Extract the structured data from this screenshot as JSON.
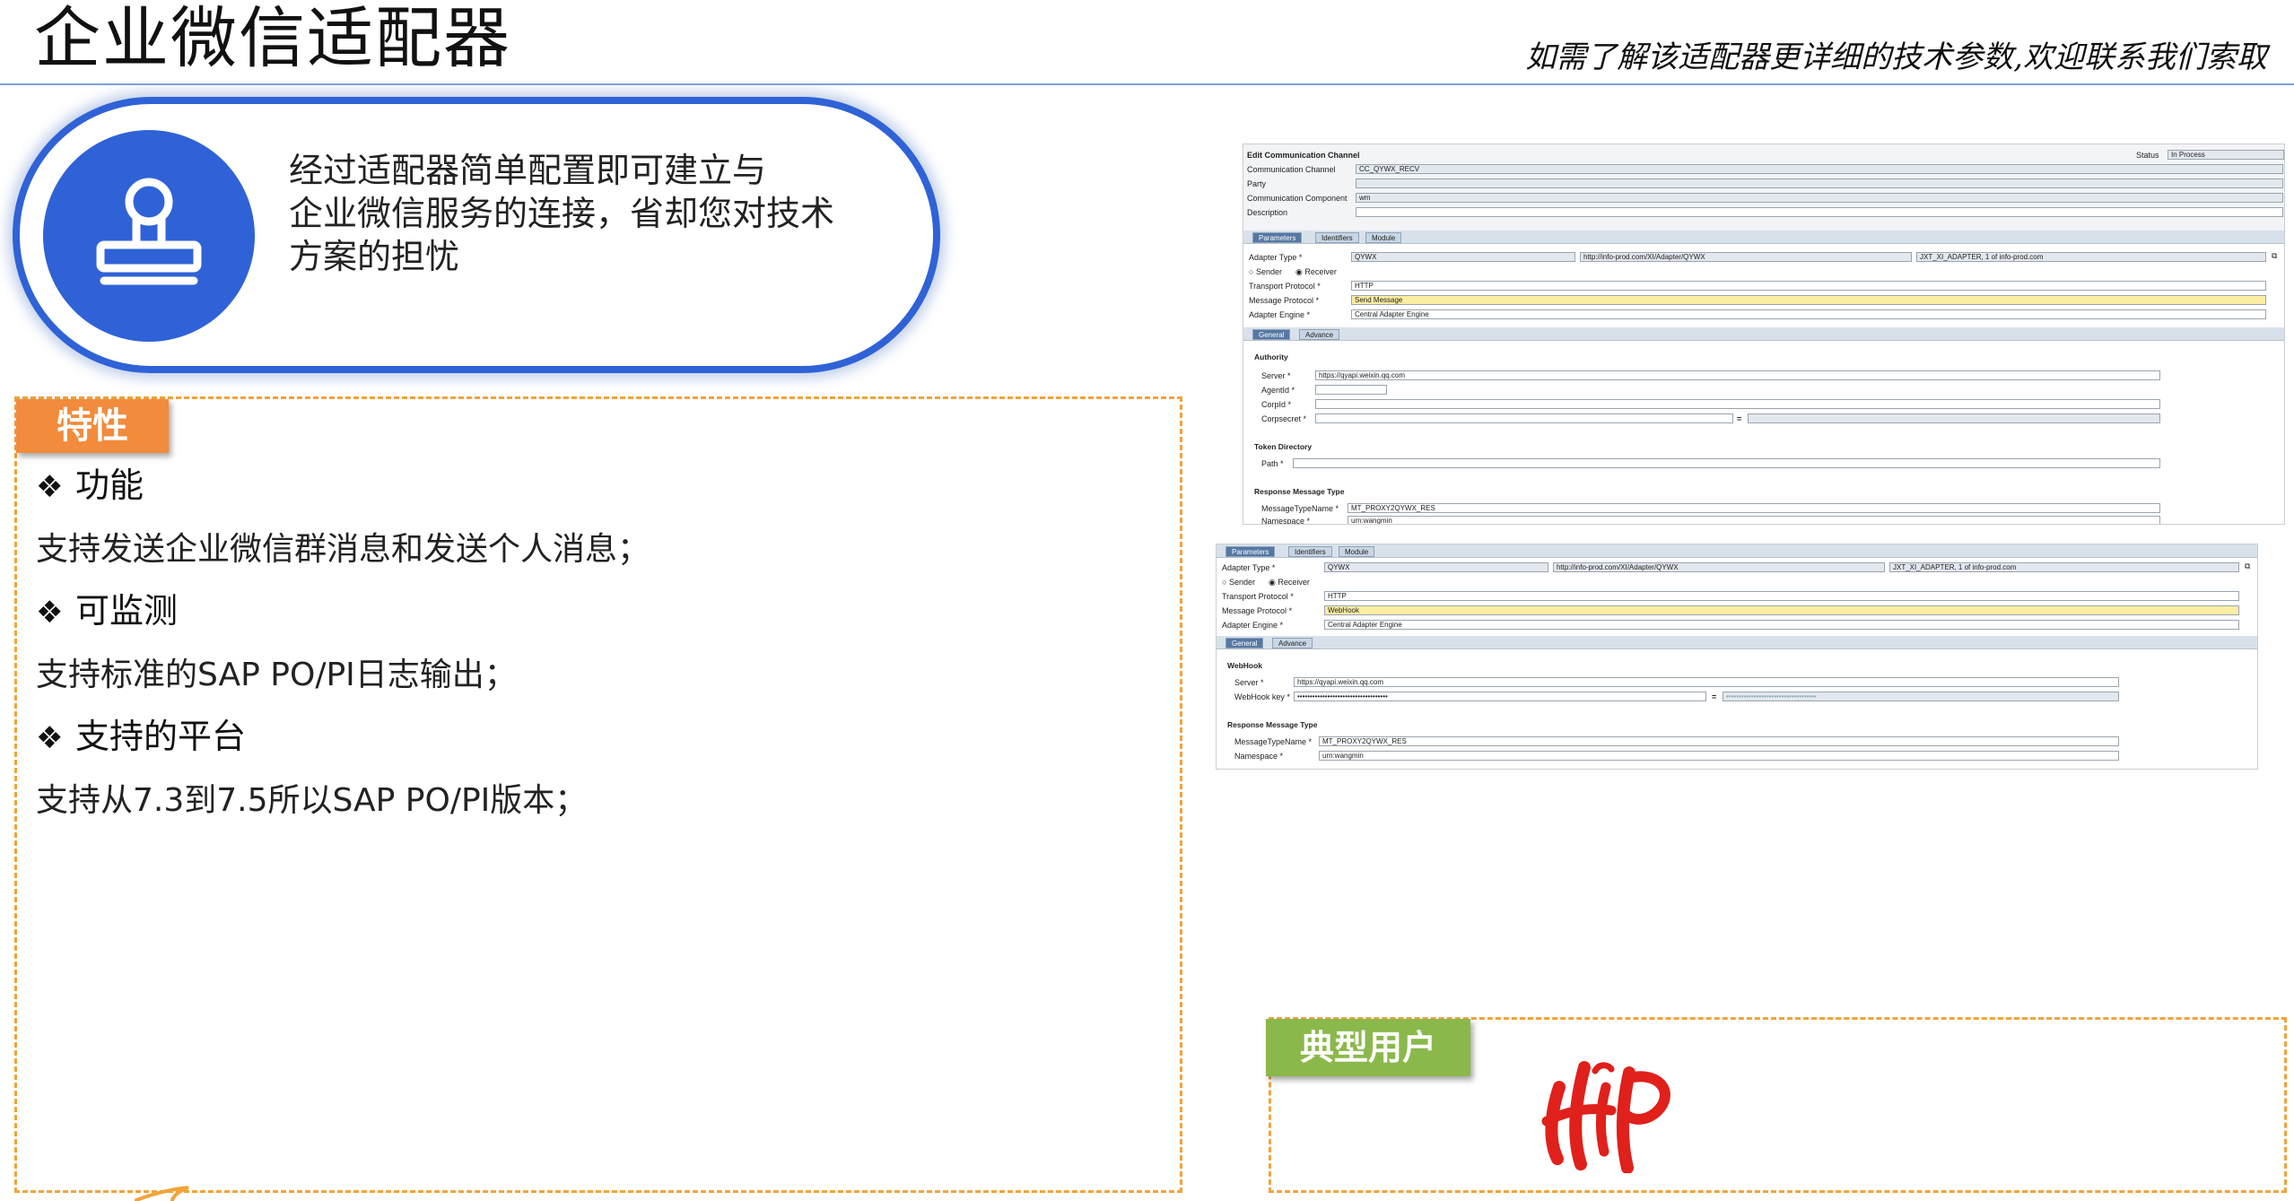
{
  "header": {
    "title": "企业微信适配器",
    "tagline": "如需了解该适配器更详细的技术参数,欢迎联系我们索取"
  },
  "intro": {
    "icon": "stamp-icon",
    "line1": "经过适配器简单配置即可建立与",
    "line2": "企业微信服务的连接，省却您对技术",
    "line3": "方案的担忧"
  },
  "features": {
    "tag": "特性",
    "items": [
      {
        "heading": "功能",
        "text": "支持发送企业微信群消息和发送个人消息；"
      },
      {
        "heading": "可监测",
        "text": "支持标准的SAP PO/PI日志输出；"
      },
      {
        "heading": "支持的平台",
        "text": "支持从7.3到7.5所以SAP PO/PI版本；"
      }
    ],
    "bullet": "❖"
  },
  "shot1": {
    "window_title": "Edit Communication Channel",
    "status_label": "Status",
    "status_value": "In Process",
    "rows": [
      {
        "label": "Communication Channel",
        "value": "CC_QYWX_RECV"
      },
      {
        "label": "Party",
        "value": ""
      },
      {
        "label": "Communication Component",
        "value": "wm"
      },
      {
        "label": "Description",
        "value": ""
      }
    ],
    "tabs": [
      "Parameters",
      "Identifiers",
      "Module"
    ],
    "adapter_type_label": "Adapter Type *",
    "adapter_type_value": "QYWX",
    "adapter_ns": "http://info-prod.com/XI/Adapter/QYWX",
    "adapter_sw": "JXT_XI_ADAPTER, 1 of info-prod.com",
    "sender_label": "Sender",
    "receiver_label": "Receiver",
    "transport_label": "Transport Protocol *",
    "transport_value": "HTTP",
    "msgproto_label": "Message Protocol *",
    "msgproto_value": "Send Message",
    "engine_label": "Adapter Engine *",
    "engine_value": "Central Adapter Engine",
    "subtabs": [
      "General",
      "Advance"
    ],
    "authority": "Authority",
    "server_label": "Server *",
    "server_value": "https://qyapi.weixin.qq.com",
    "agentid_label": "AgentId *",
    "corpid_label": "CorpId *",
    "corpsecret_label": "Corpsecret *",
    "eq": "=",
    "token_dir": "Token Directory",
    "path_label": "Path *",
    "resp_type": "Response Message Type",
    "mtname_label": "MessageTypeName *",
    "mtname_value": "MT_PROXY2QYWX_RES",
    "ns_label": "Namespace *",
    "ns_value": "urn:wangmin"
  },
  "shot2": {
    "tabs": [
      "Parameters",
      "Identifiers",
      "Module"
    ],
    "adapter_type_label": "Adapter Type *",
    "adapter_type_value": "QYWX",
    "adapter_ns": "http://info-prod.com/XI/Adapter/QYWX",
    "adapter_sw": "JXT_XI_ADAPTER, 1 of info-prod.com",
    "sender_label": "Sender",
    "receiver_label": "Receiver",
    "transport_label": "Transport Protocol *",
    "transport_value": "HTTP",
    "msgproto_label": "Message Protocol *",
    "msgproto_value": "WebHook",
    "engine_label": "Adapter Engine *",
    "engine_value": "Central Adapter Engine",
    "subtabs": [
      "General",
      "Advance"
    ],
    "webhook": "WebHook",
    "server_label": "Server *",
    "server_value": "https://qyapi.weixin.qq.com",
    "key_label": "WebHook key *",
    "key_value": "••••••••••••••••••••••••••••••••••••",
    "key_confirm": "••••••••••••••••••••••••••••••••••••",
    "eq": "=",
    "resp_type": "Response Message Type",
    "mtname_label": "MessageTypeName *",
    "mtname_value": "MT_PROXY2QYWX_RES",
    "ns_label": "Namespace *",
    "ns_value": "urn:wangmin"
  },
  "users": {
    "tag": "典型用户",
    "logo": "customer-logo-red"
  },
  "colors": {
    "accent_blue": "#2f62d6",
    "orange_tag": "#f28b3c",
    "green_tag": "#8bb84b",
    "dash_orange": "#f2a33a",
    "logo_red": "#e0201b"
  }
}
